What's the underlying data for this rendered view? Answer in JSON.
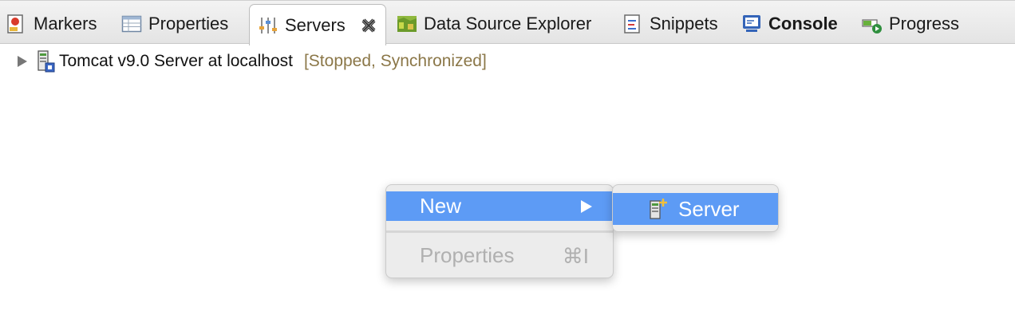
{
  "tabs": [
    {
      "label": "Markers",
      "icon": "markers-icon"
    },
    {
      "label": "Properties",
      "icon": "properties-icon"
    },
    {
      "label": "Servers",
      "icon": "servers-icon",
      "active": true
    },
    {
      "label": "Data Source Explorer",
      "icon": "data-source-explorer-icon"
    },
    {
      "label": "Snippets",
      "icon": "snippets-icon"
    },
    {
      "label": "Console",
      "icon": "console-icon",
      "bold": true
    },
    {
      "label": "Progress",
      "icon": "progress-icon"
    }
  ],
  "tree": {
    "server_name": "Tomcat v9.0 Server at localhost",
    "status": "[Stopped, Synchronized]"
  },
  "context_menu": {
    "new_label": "New",
    "properties_label": "Properties",
    "properties_shortcut": "⌘I"
  },
  "submenu": {
    "server_label": "Server"
  },
  "colors": {
    "menu_highlight": "#5d9bf5",
    "status_text": "#8b7748",
    "disabled_text": "#b0b0b0"
  }
}
